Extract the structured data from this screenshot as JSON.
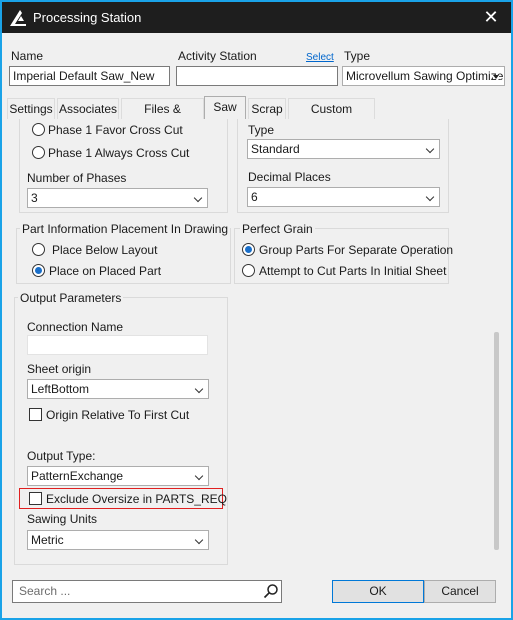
{
  "window": {
    "title": "Processing Station"
  },
  "header": {
    "name_label": "Name",
    "name_value": "Imperial Default Saw_New",
    "activity_label": "Activity Station",
    "activity_value": "",
    "select_link": "Select",
    "type_label": "Type",
    "type_value": "Microvellum Sawing Optimizer"
  },
  "tabs": [
    {
      "label": "Settings",
      "active": false
    },
    {
      "label": "Associates",
      "active": false
    },
    {
      "label": "Files & Pictures",
      "active": false
    },
    {
      "label": "Saw",
      "active": true
    },
    {
      "label": "Scrap",
      "active": false
    },
    {
      "label": "Custom Settings",
      "active": false
    }
  ],
  "cut_options": {
    "phase1_favor_cross_cut": {
      "label": "Phase 1 Favor Cross Cut",
      "selected": false
    },
    "phase1_always_cross_cut": {
      "label": "Phase 1 Always Cross Cut",
      "selected": false
    },
    "phases_label": "Number of Phases",
    "phases_value": "3"
  },
  "type_section": {
    "type_label": "Type",
    "type_value": "Standard",
    "decimal_label": "Decimal Places",
    "decimal_value": "6"
  },
  "part_info": {
    "title": "Part Information Placement In Drawing",
    "place_below": {
      "label": "Place Below Layout",
      "selected": false
    },
    "place_on": {
      "label": "Place on Placed Part",
      "selected": true
    }
  },
  "perfect_grain": {
    "title": "Perfect Grain",
    "group_parts": {
      "label": "Group Parts For Separate Operation",
      "selected": true
    },
    "attempt_cut": {
      "label": "Attempt to Cut Parts In Initial Sheet",
      "selected": false
    }
  },
  "output": {
    "title": "Output Parameters",
    "connection_label": "Connection Name",
    "connection_value": "",
    "sheet_origin_label": "Sheet origin",
    "sheet_origin_value": "LeftBottom",
    "origin_relative_label": "Origin Relative To First Cut",
    "origin_relative_checked": false,
    "output_type_label": "Output Type:",
    "output_type_value": "PatternExchange",
    "exclude_oversize_label": "Exclude Oversize in PARTS_REQ",
    "exclude_oversize_checked": false,
    "sawing_units_label": "Sawing Units",
    "sawing_units_value": "Metric"
  },
  "footer": {
    "search_placeholder": "Search ...",
    "ok_label": "OK",
    "cancel_label": "Cancel"
  },
  "colors": {
    "window_border": "#1aa3e8",
    "titlebar": "#1e1e1e",
    "highlight_box": "#e02020",
    "radio_dot": "#1a6fc9"
  }
}
